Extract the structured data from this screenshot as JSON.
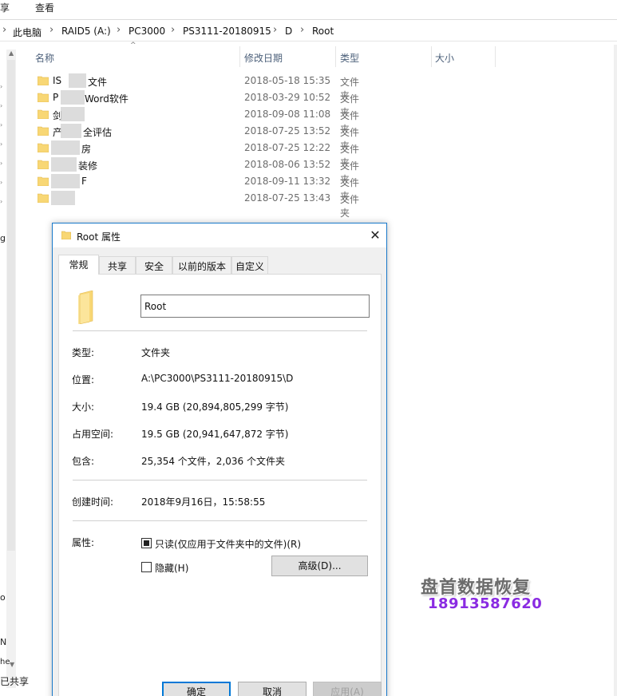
{
  "ribbon": {
    "tabs": [
      "享",
      "查看"
    ]
  },
  "breadcrumb": {
    "items": [
      "此电脑",
      "RAID5 (A:)",
      "PC3000",
      "PS3111-20180915",
      "D",
      "Root"
    ],
    "separator": "›"
  },
  "columns": {
    "name": "名称",
    "date": "修改日期",
    "type": "类型",
    "size": "大小"
  },
  "files": [
    {
      "name_start": "IS",
      "name_end": "文件",
      "date": "2018-05-18 15:35",
      "type": "文件夹"
    },
    {
      "name_start": "P",
      "name_end": "Word软件",
      "date": "2018-03-29 10:52",
      "type": "文件夹"
    },
    {
      "name_start": "剑",
      "name_end": "",
      "date": "2018-09-08 11:08",
      "type": "文件夹"
    },
    {
      "name_start": "产",
      "name_end": "全评估",
      "date": "2018-07-25 13:52",
      "type": "文件夹"
    },
    {
      "name_start": "",
      "name_end": "房",
      "date": "2018-07-25 12:22",
      "type": "文件夹"
    },
    {
      "name_start": "",
      "name_end": "装修",
      "date": "2018-08-06 13:52",
      "type": "文件夹"
    },
    {
      "name_start": "",
      "name_end": "F",
      "date": "2018-09-11 13:32",
      "type": "文件夹"
    },
    {
      "name_start": "",
      "name_end": "",
      "date": "2018-07-25 13:43",
      "type": "文件夹"
    }
  ],
  "nav_fragments": [
    "g",
    "o",
    "N",
    "he",
    "已共享"
  ],
  "dialog": {
    "title": "Root 属性",
    "close": "✕",
    "tabs": [
      "常规",
      "共享",
      "安全",
      "以前的版本",
      "自定义"
    ],
    "name_value": "Root",
    "props": {
      "type_label": "类型:",
      "type_value": "文件夹",
      "location_label": "位置:",
      "location_value": "A:\\PC3000\\PS3111-20180915\\D",
      "size_label": "大小:",
      "size_value": "19.4 GB (20,894,805,299 字节)",
      "disk_label": "占用空间:",
      "disk_value": "19.5 GB (20,941,647,872 字节)",
      "contains_label": "包含:",
      "contains_value": "25,354 个文件，2,036 个文件夹",
      "created_label": "创建时间:",
      "created_value": "2018年9月16日，15:58:55",
      "attr_label": "属性:",
      "readonly_label": "只读(仅应用于文件夹中的文件)(R)",
      "hidden_label": "隐藏(H)",
      "advanced_button": "高级(D)..."
    },
    "buttons": {
      "ok": "确定",
      "cancel": "取消",
      "apply": "应用(A)"
    }
  },
  "watermark": {
    "title": "盘首数据恢复",
    "phone": "18913587620",
    "title_color": "#6b6b6b",
    "phone_color": "#8a2be2"
  },
  "colors": {
    "folder": "#f8d775",
    "accent": "#0078d7",
    "dialog_border": "#1979ca"
  }
}
